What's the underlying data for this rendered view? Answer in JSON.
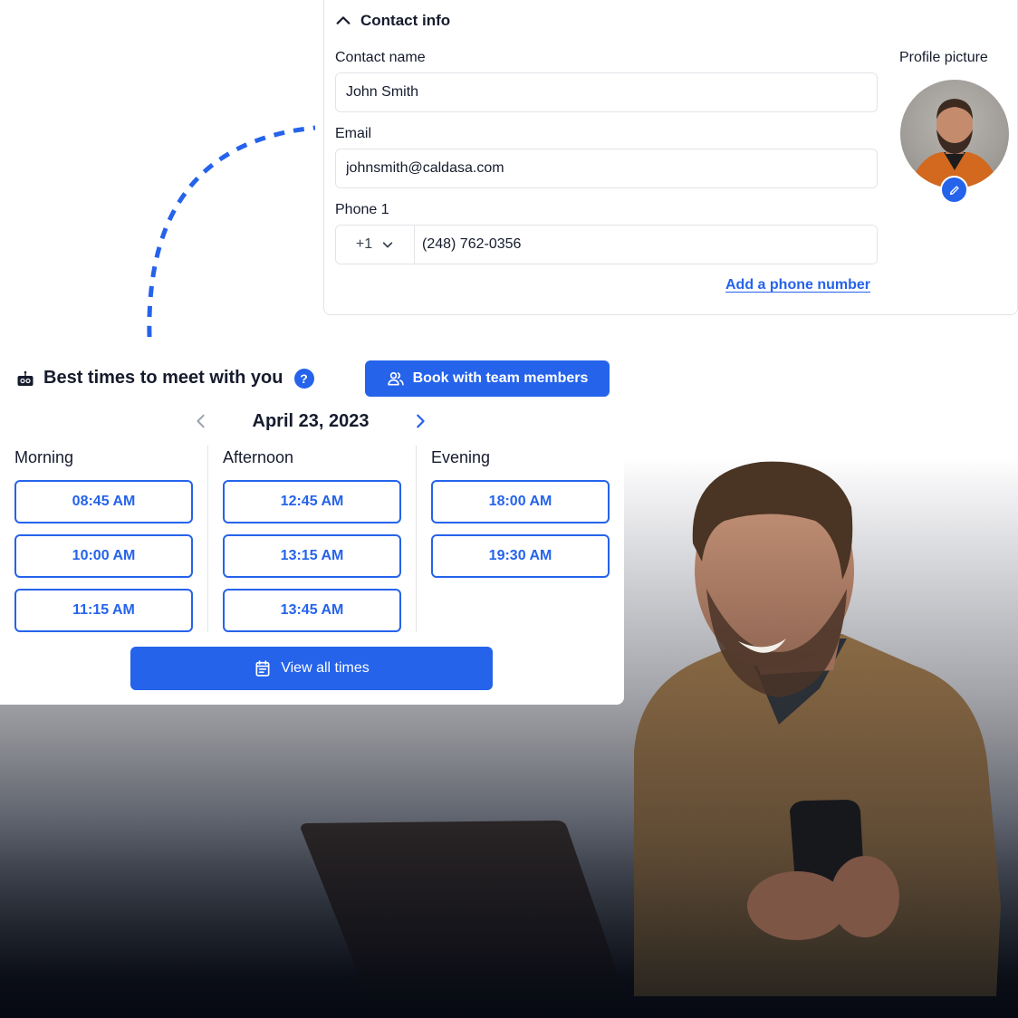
{
  "contact_info": {
    "section_title": "Contact info",
    "contact_name": {
      "label": "Contact name",
      "value": "John Smith"
    },
    "email": {
      "label": "Email",
      "value": "johnsmith@caldasa.com"
    },
    "phone": {
      "label": "Phone 1",
      "country_code": "+1",
      "value": "(248) 762-0356"
    },
    "add_phone_link": "Add a phone number",
    "profile_picture_label": "Profile picture"
  },
  "best_times": {
    "title": "Best times to meet with you",
    "help_glyph": "?",
    "book_button": "Book with team members",
    "date": "April 23, 2023",
    "columns": [
      {
        "label": "Morning",
        "slots": [
          "08:45 AM",
          "10:00 AM",
          "11:15 AM"
        ]
      },
      {
        "label": "Afternoon",
        "slots": [
          "12:45 AM",
          "13:15 AM",
          "13:45 AM"
        ]
      },
      {
        "label": "Evening",
        "slots": [
          "18:00 AM",
          "19:30 AM"
        ]
      }
    ],
    "view_all_button": "View all times"
  },
  "icons": {
    "collapse": "chevron-up-icon",
    "dropdown": "chevron-down-icon",
    "edit": "pencil-icon",
    "robot": "robot-icon",
    "help": "question-icon",
    "team": "users-icon",
    "prev": "chevron-left-icon",
    "next": "chevron-right-icon",
    "calendar": "calendar-icon"
  },
  "colors": {
    "accent": "#2563eb",
    "text": "#161c2d",
    "border": "#e3e4e8",
    "muted_arrow": "#9ca3af"
  }
}
